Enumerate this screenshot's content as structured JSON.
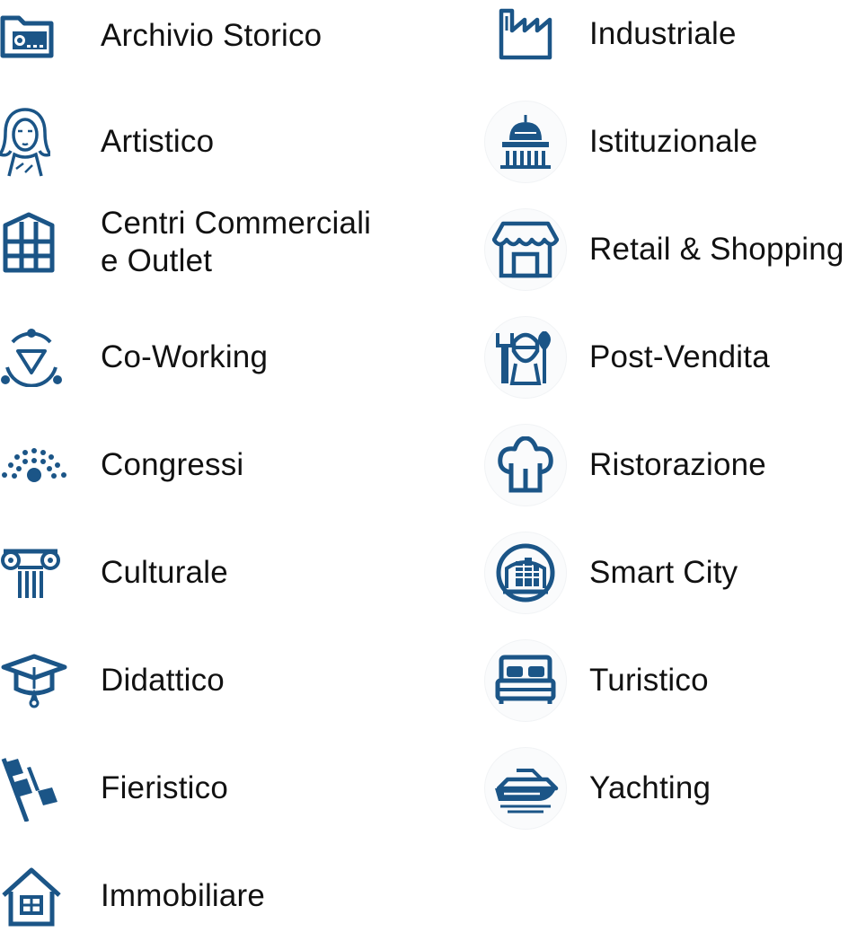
{
  "accent_color": "#1b5587",
  "left_items": [
    {
      "label": "Archivio Storico",
      "icon": "archive-folder-icon"
    },
    {
      "label": "Artistico",
      "icon": "mona-lisa-icon"
    },
    {
      "label_line1": "Centri Commerciali",
      "label_line2": "e Outlet",
      "icon": "building-icon"
    },
    {
      "label": "Co-Working",
      "icon": "network-triangle-icon"
    },
    {
      "label": "Congressi",
      "icon": "audience-dots-icon"
    },
    {
      "label": "Culturale",
      "icon": "ionic-column-icon"
    },
    {
      "label": "Didattico",
      "icon": "graduation-cap-icon"
    },
    {
      "label": "Fieristico",
      "icon": "flags-icon"
    },
    {
      "label": "Immobiliare",
      "icon": "house-icon"
    }
  ],
  "right_items": [
    {
      "label": "Industriale",
      "icon": "factory-icon"
    },
    {
      "label": "Istituzionale",
      "icon": "capitol-dome-icon"
    },
    {
      "label": "Retail & Shopping",
      "icon": "storefront-icon"
    },
    {
      "label": "Post-Vendita",
      "icon": "mechanic-tools-icon"
    },
    {
      "label": "Ristorazione",
      "icon": "chef-hat-icon"
    },
    {
      "label": "Smart City",
      "icon": "smart-city-icon"
    },
    {
      "label": "Turistico",
      "icon": "bed-icon"
    },
    {
      "label": "Yachting",
      "icon": "yacht-icon"
    }
  ]
}
